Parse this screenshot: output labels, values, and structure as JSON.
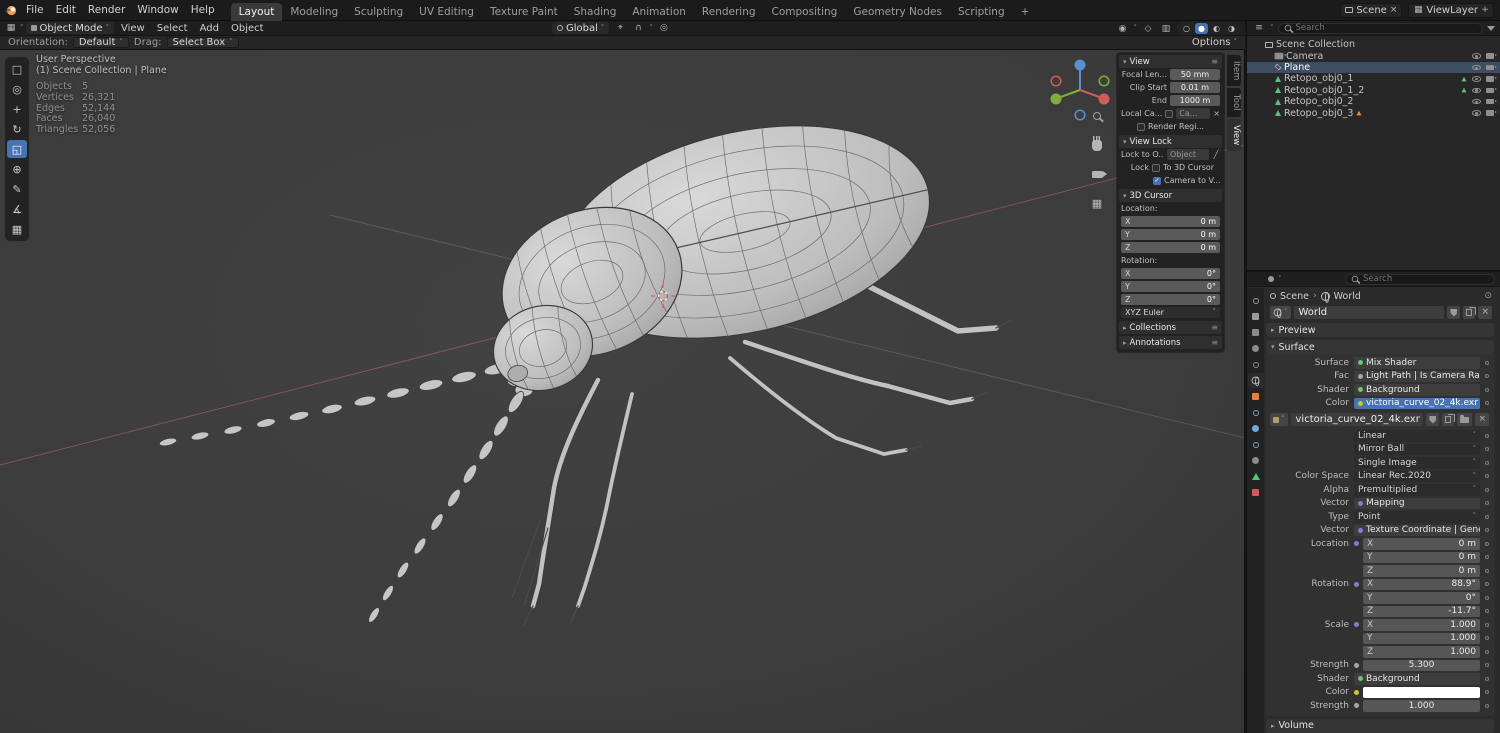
{
  "icons": {
    "chevron_down": "˅",
    "panel_open": "▾",
    "panel_closed": "▸",
    "menu": "≡",
    "close": "×",
    "check": "✓",
    "grid": "▦",
    "plus": "+",
    "breadcrumb_sep": "›",
    "shading_wireframe": "○",
    "shading_solid": "●",
    "shading_material": "◐",
    "shading_rendered": "◑"
  },
  "topbar": {
    "menus": [
      "File",
      "Edit",
      "Render",
      "Window",
      "Help"
    ],
    "workspaces": [
      "Layout",
      "Modeling",
      "Sculpting",
      "UV Editing",
      "Texture Paint",
      "Shading",
      "Animation",
      "Rendering",
      "Compositing",
      "Geometry Nodes",
      "Scripting"
    ],
    "add_workspace": "+",
    "scene_name": "Scene",
    "viewlayer_name": "ViewLayer"
  },
  "viewport_header": {
    "mode": "Object Mode",
    "menus": [
      "View",
      "Select",
      "Add",
      "Object"
    ],
    "orientation": "Global"
  },
  "tool_header": {
    "orientation_label": "Orientation:",
    "orientation_value": "Default",
    "drag_label": "Drag:",
    "drag_value": "Select Box",
    "options_label": "Options"
  },
  "tools": [
    {
      "name": "select-box",
      "glyph": "□"
    },
    {
      "name": "cursor",
      "glyph": "◎"
    },
    {
      "name": "move",
      "glyph": "+"
    },
    {
      "name": "rotate",
      "glyph": "↻"
    },
    {
      "name": "scale",
      "glyph": "◱"
    },
    {
      "name": "transform",
      "glyph": "⊕"
    },
    {
      "name": "annotate",
      "glyph": "✎"
    },
    {
      "name": "measure",
      "glyph": "∡"
    },
    {
      "name": "add-cube",
      "glyph": "▦"
    }
  ],
  "viewport": {
    "stats": {
      "view_name": "User Perspective",
      "context": "(1) Scene Collection | Plane",
      "rows": [
        {
          "label": "Objects",
          "value": "5"
        },
        {
          "label": "Vertices",
          "value": "26,321"
        },
        {
          "label": "Edges",
          "value": "52,144"
        },
        {
          "label": "Faces",
          "value": "26,040"
        },
        {
          "label": "Triangles",
          "value": "52,056"
        }
      ]
    }
  },
  "npanel": {
    "tabs": [
      "Item",
      "Tool",
      "View"
    ],
    "view": {
      "title": "View",
      "focal_label": "Focal Len...",
      "focal_value": "50 mm",
      "clip_label": "Clip Start",
      "clip_value": "0.01 m",
      "end_label": "End",
      "end_value": "1000 m",
      "local_cam_label": "Local Ca...",
      "local_cam_value": "Ca...",
      "render_region_label": "Render Regi..."
    },
    "view_lock": {
      "title": "View Lock",
      "lock_to_label": "Lock to O...",
      "lock_to_value": "Object",
      "lock_label": "Lock",
      "cursor_label": "To 3D Cursor",
      "camera_label": "Camera to V..."
    },
    "cursor": {
      "title": "3D Cursor",
      "location_label": "Location:",
      "rotation_label": "Rotation:",
      "loc": [
        {
          "a": "X",
          "v": "0 m"
        },
        {
          "a": "Y",
          "v": "0 m"
        },
        {
          "a": "Z",
          "v": "0 m"
        }
      ],
      "rot": [
        {
          "a": "X",
          "v": "0°"
        },
        {
          "a": "Y",
          "v": "0°"
        },
        {
          "a": "Z",
          "v": "0°"
        }
      ],
      "euler": "XYZ Euler"
    },
    "collections": "Collections",
    "annotations": "Annotations"
  },
  "outliner": {
    "search_placeholder": "Search",
    "root_label": "Scene Collection",
    "items": [
      {
        "name": "Camera"
      },
      {
        "name": "Plane"
      },
      {
        "name": "Retopo_obj0_1"
      },
      {
        "name": "Retopo_obj0_1_2"
      },
      {
        "name": "Retopo_obj0_2"
      },
      {
        "name": "Retopo_obj0_3"
      }
    ]
  },
  "properties": {
    "search_placeholder": "Search",
    "breadcrumb": {
      "scene": "Scene",
      "world": "World"
    },
    "world_name": "World",
    "panels": {
      "preview": "Preview",
      "surface": "Surface",
      "volume": "Volume"
    },
    "rows": {
      "surface_label": "Surface",
      "surface_value": "Mix Shader",
      "fac_label": "Fac",
      "fac_value": "Light Path | Is Camera Ray",
      "shader1_label": "Shader",
      "shader1_value": "Background",
      "color1_label": "Color",
      "color1_value": "victoria_curve_02_4k.exr",
      "image_name": "victoria_curve_02_4k.exr",
      "interpolation": "Linear",
      "projection": "Mirror Ball",
      "source": "Single Image",
      "colorspace_label": "Color Space",
      "colorspace_value": "Linear Rec.2020",
      "alpha_label": "Alpha",
      "alpha_value": "Premultiplied",
      "vector1_label": "Vector",
      "vector1_value": "Mapping",
      "type_label": "Type",
      "type_value": "Point",
      "vector2_label": "Vector",
      "vector2_value": "Texture Coordinate | Generated",
      "location_label": "Location",
      "rotation_label": "Rotation",
      "scale_label": "Scale",
      "loc": [
        {
          "a": "X",
          "v": "0 m"
        },
        {
          "a": "Y",
          "v": "0 m"
        },
        {
          "a": "Z",
          "v": "0 m"
        }
      ],
      "rot": [
        {
          "a": "X",
          "v": "88.9°"
        },
        {
          "a": "Y",
          "v": "0°"
        },
        {
          "a": "Z",
          "v": "-11.7°"
        }
      ],
      "scl": [
        {
          "a": "X",
          "v": "1.000"
        },
        {
          "a": "Y",
          "v": "1.000"
        },
        {
          "a": "Z",
          "v": "1.000"
        }
      ],
      "strength1_label": "Strength",
      "strength1_value": "5.300",
      "shader2_label": "Shader",
      "shader2_value": "Background",
      "color2_label": "Color",
      "strength2_label": "Strength",
      "strength2_value": "1.000"
    }
  }
}
